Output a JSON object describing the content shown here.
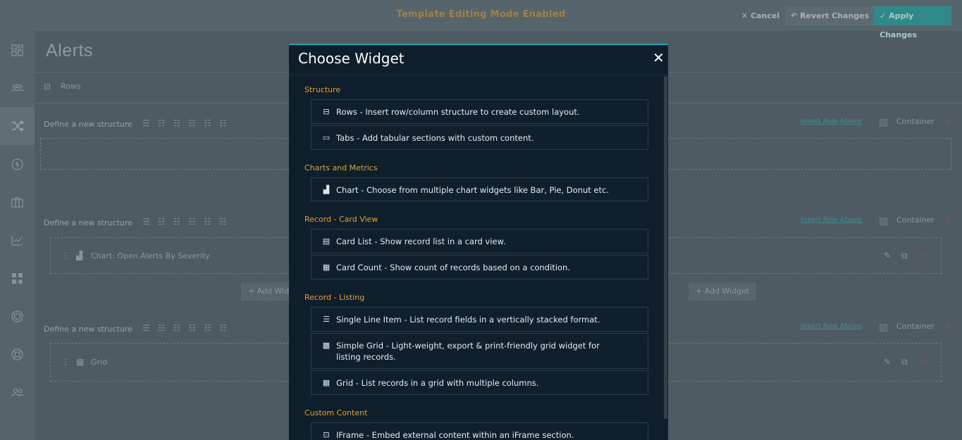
{
  "topbar": {
    "mode_text": "Template Editing Mode Enabled",
    "cancel_label": "Cancel",
    "revert_label": "Revert Changes",
    "apply_label": "Apply Changes"
  },
  "page": {
    "title": "Alerts",
    "rows_label": "Rows",
    "define_label": "Define a new structure",
    "insert_row_above": "Insert Row Above",
    "container_label": "Container",
    "widget_chart_label": "Chart: Open Alerts By Severity",
    "widget_grid_label": "Grid",
    "add_widget_label": "Add Widget",
    "add_widget_partial": "Add Wid"
  },
  "modal": {
    "title": "Choose Widget",
    "close": "✕",
    "categories": [
      {
        "label": "Structure"
      },
      {
        "label": "Charts and Metrics"
      },
      {
        "label": "Record - Card View"
      },
      {
        "label": "Record - Listing"
      },
      {
        "label": "Custom Content"
      }
    ],
    "items": [
      {
        "icon": "rows-icon",
        "text": "Rows - Insert row/column structure to create custom layout."
      },
      {
        "icon": "tabs-icon",
        "text": "Tabs - Add tabular sections with custom content."
      },
      {
        "icon": "chart-icon",
        "text": "Chart - Choose from multiple chart widgets like Bar, Pie, Donut etc."
      },
      {
        "icon": "card-list-icon",
        "text": "Card List - Show record list in a card view."
      },
      {
        "icon": "card-count-icon",
        "text": "Card Count - Show count of records based on a condition."
      },
      {
        "icon": "single-line-icon",
        "text": "Single Line Item - List record fields in a vertically stacked format."
      },
      {
        "icon": "simple-grid-icon",
        "text": "Simple Grid - Light-weight, export & print-friendly grid widget for listing records."
      },
      {
        "icon": "grid-icon",
        "text": "Grid - List records in a grid with multiple columns."
      },
      {
        "icon": "iframe-icon",
        "text": "IFrame - Embed external content within an iFrame section."
      }
    ]
  },
  "colors": {
    "modal_bg": "#0e1e2a",
    "accent": "#1fa3b5",
    "category": "#e0a22a",
    "apply": "#2f8a87"
  }
}
